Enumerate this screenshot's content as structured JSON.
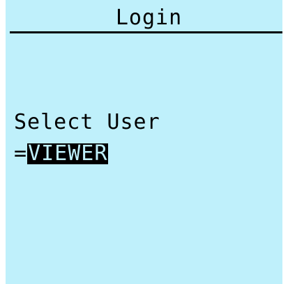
{
  "header": {
    "title": "Login"
  },
  "main": {
    "prompt": "Select User",
    "prefix": "=",
    "selected_user": "VIEWER"
  },
  "colors": {
    "background": "#bff0fb",
    "foreground": "#000000",
    "highlight": "#000000"
  }
}
